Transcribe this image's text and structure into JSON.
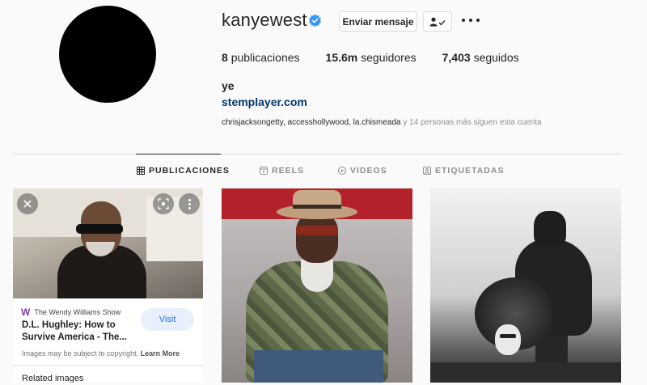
{
  "profile": {
    "username": "kanyewest",
    "verified": true,
    "message_button": "Enviar mensaje",
    "stats": {
      "posts_count": "8",
      "posts_label": "publicaciones",
      "followers_count": "15.6m",
      "followers_label": "seguidores",
      "following_count": "7,403",
      "following_label": "seguidos"
    },
    "bio_name": "ye",
    "bio_link": "stemplayer.com",
    "followed_by_names": "chrisjacksongetty, accesshollywood, la.chismeada",
    "followed_by_suffix": " y 14 personas más siguen esta cuenta"
  },
  "tabs": [
    {
      "label": "PUBLICACIONES",
      "icon": "grid-icon",
      "active": true
    },
    {
      "label": "REELS",
      "icon": "reels-icon",
      "active": false
    },
    {
      "label": "VIDEOS",
      "icon": "play-icon",
      "active": false
    },
    {
      "label": "ETIQUETADAS",
      "icon": "tag-icon",
      "active": false
    }
  ],
  "image_card": {
    "source": "The Wendy Williams Show",
    "title": "D.L. Hughley: How to Survive America - The...",
    "visit_label": "Visit",
    "copyright_text": "Images may be subject to copyright.",
    "learn_more": "Learn More",
    "related_label": "Related images"
  },
  "colors": {
    "verified_blue": "#3897f0",
    "link_blue": "#00376b",
    "visit_blue": "#1a73e8"
  }
}
